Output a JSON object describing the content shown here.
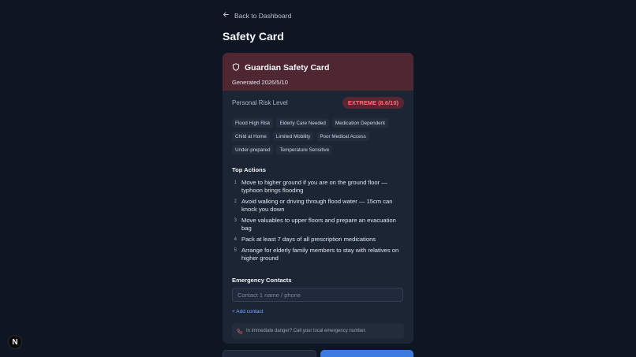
{
  "nav": {
    "back_label": "Back to Dashboard"
  },
  "page": {
    "title": "Safety Card"
  },
  "card": {
    "title": "Guardian Safety Card",
    "generated": "Generated 2026/5/10",
    "risk_label": "Personal Risk Level",
    "risk_badge": "EXTREME (8.6/10)",
    "tags": [
      "Flood High Risk",
      "Elderly Care Needed",
      "Medication Dependent",
      "Child at Home",
      "Limited Mobility",
      "Poor Medical Access",
      "Under-prepared",
      "Temperature Sensitive"
    ],
    "actions_title": "Top Actions",
    "actions": [
      {
        "num": "1",
        "text": "Move to higher ground if you are on the ground floor — typhoon brings flooding"
      },
      {
        "num": "2",
        "text": "Avoid walking or driving through flood water — 15cm can knock you down"
      },
      {
        "num": "3",
        "text": "Move valuables to upper floors and prepare an evacuation bag"
      },
      {
        "num": "4",
        "text": "Pack at least 7 days of all prescription medications"
      },
      {
        "num": "5",
        "text": "Arrange for elderly family members to stay with relatives on higher ground"
      }
    ],
    "contacts_title": "Emergency Contacts",
    "contact_placeholder": "Contact 1 name / phone",
    "add_contact": "+ Add contact",
    "danger_text": "In immediate danger? Call your local emergency number."
  },
  "badge": {
    "letter": "N"
  },
  "colors": {
    "accent": "#3a7be0",
    "risk": "#ff6b78",
    "header_bg": "#4f2733"
  },
  "icons": {
    "back": "arrow-left-icon",
    "shield": "shield-icon",
    "phone": "phone-icon"
  }
}
